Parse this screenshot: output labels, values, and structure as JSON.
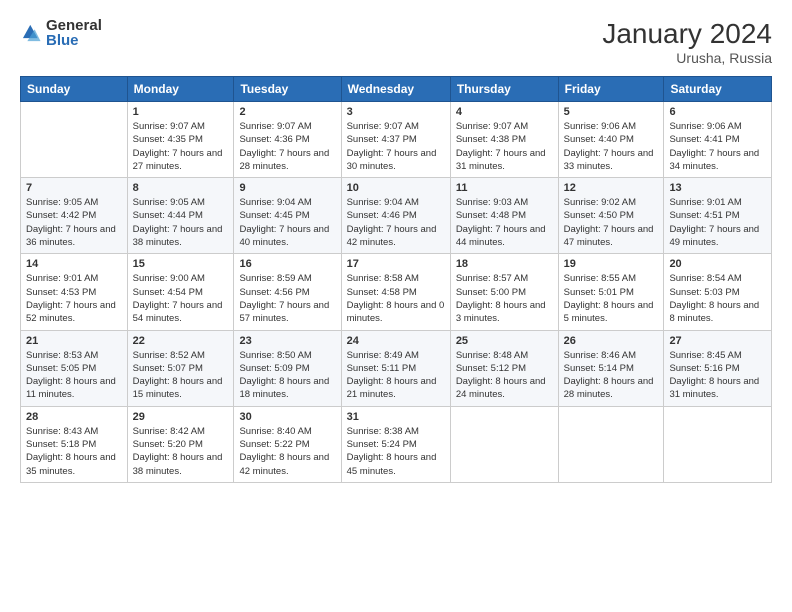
{
  "logo": {
    "general": "General",
    "blue": "Blue"
  },
  "header": {
    "month": "January 2024",
    "location": "Urusha, Russia"
  },
  "columns": [
    "Sunday",
    "Monday",
    "Tuesday",
    "Wednesday",
    "Thursday",
    "Friday",
    "Saturday"
  ],
  "weeks": [
    [
      {
        "day": "",
        "sunrise": "",
        "sunset": "",
        "daylight": ""
      },
      {
        "day": "1",
        "sunrise": "Sunrise: 9:07 AM",
        "sunset": "Sunset: 4:35 PM",
        "daylight": "Daylight: 7 hours and 27 minutes."
      },
      {
        "day": "2",
        "sunrise": "Sunrise: 9:07 AM",
        "sunset": "Sunset: 4:36 PM",
        "daylight": "Daylight: 7 hours and 28 minutes."
      },
      {
        "day": "3",
        "sunrise": "Sunrise: 9:07 AM",
        "sunset": "Sunset: 4:37 PM",
        "daylight": "Daylight: 7 hours and 30 minutes."
      },
      {
        "day": "4",
        "sunrise": "Sunrise: 9:07 AM",
        "sunset": "Sunset: 4:38 PM",
        "daylight": "Daylight: 7 hours and 31 minutes."
      },
      {
        "day": "5",
        "sunrise": "Sunrise: 9:06 AM",
        "sunset": "Sunset: 4:40 PM",
        "daylight": "Daylight: 7 hours and 33 minutes."
      },
      {
        "day": "6",
        "sunrise": "Sunrise: 9:06 AM",
        "sunset": "Sunset: 4:41 PM",
        "daylight": "Daylight: 7 hours and 34 minutes."
      }
    ],
    [
      {
        "day": "7",
        "sunrise": "Sunrise: 9:05 AM",
        "sunset": "Sunset: 4:42 PM",
        "daylight": "Daylight: 7 hours and 36 minutes."
      },
      {
        "day": "8",
        "sunrise": "Sunrise: 9:05 AM",
        "sunset": "Sunset: 4:44 PM",
        "daylight": "Daylight: 7 hours and 38 minutes."
      },
      {
        "day": "9",
        "sunrise": "Sunrise: 9:04 AM",
        "sunset": "Sunset: 4:45 PM",
        "daylight": "Daylight: 7 hours and 40 minutes."
      },
      {
        "day": "10",
        "sunrise": "Sunrise: 9:04 AM",
        "sunset": "Sunset: 4:46 PM",
        "daylight": "Daylight: 7 hours and 42 minutes."
      },
      {
        "day": "11",
        "sunrise": "Sunrise: 9:03 AM",
        "sunset": "Sunset: 4:48 PM",
        "daylight": "Daylight: 7 hours and 44 minutes."
      },
      {
        "day": "12",
        "sunrise": "Sunrise: 9:02 AM",
        "sunset": "Sunset: 4:50 PM",
        "daylight": "Daylight: 7 hours and 47 minutes."
      },
      {
        "day": "13",
        "sunrise": "Sunrise: 9:01 AM",
        "sunset": "Sunset: 4:51 PM",
        "daylight": "Daylight: 7 hours and 49 minutes."
      }
    ],
    [
      {
        "day": "14",
        "sunrise": "Sunrise: 9:01 AM",
        "sunset": "Sunset: 4:53 PM",
        "daylight": "Daylight: 7 hours and 52 minutes."
      },
      {
        "day": "15",
        "sunrise": "Sunrise: 9:00 AM",
        "sunset": "Sunset: 4:54 PM",
        "daylight": "Daylight: 7 hours and 54 minutes."
      },
      {
        "day": "16",
        "sunrise": "Sunrise: 8:59 AM",
        "sunset": "Sunset: 4:56 PM",
        "daylight": "Daylight: 7 hours and 57 minutes."
      },
      {
        "day": "17",
        "sunrise": "Sunrise: 8:58 AM",
        "sunset": "Sunset: 4:58 PM",
        "daylight": "Daylight: 8 hours and 0 minutes."
      },
      {
        "day": "18",
        "sunrise": "Sunrise: 8:57 AM",
        "sunset": "Sunset: 5:00 PM",
        "daylight": "Daylight: 8 hours and 3 minutes."
      },
      {
        "day": "19",
        "sunrise": "Sunrise: 8:55 AM",
        "sunset": "Sunset: 5:01 PM",
        "daylight": "Daylight: 8 hours and 5 minutes."
      },
      {
        "day": "20",
        "sunrise": "Sunrise: 8:54 AM",
        "sunset": "Sunset: 5:03 PM",
        "daylight": "Daylight: 8 hours and 8 minutes."
      }
    ],
    [
      {
        "day": "21",
        "sunrise": "Sunrise: 8:53 AM",
        "sunset": "Sunset: 5:05 PM",
        "daylight": "Daylight: 8 hours and 11 minutes."
      },
      {
        "day": "22",
        "sunrise": "Sunrise: 8:52 AM",
        "sunset": "Sunset: 5:07 PM",
        "daylight": "Daylight: 8 hours and 15 minutes."
      },
      {
        "day": "23",
        "sunrise": "Sunrise: 8:50 AM",
        "sunset": "Sunset: 5:09 PM",
        "daylight": "Daylight: 8 hours and 18 minutes."
      },
      {
        "day": "24",
        "sunrise": "Sunrise: 8:49 AM",
        "sunset": "Sunset: 5:11 PM",
        "daylight": "Daylight: 8 hours and 21 minutes."
      },
      {
        "day": "25",
        "sunrise": "Sunrise: 8:48 AM",
        "sunset": "Sunset: 5:12 PM",
        "daylight": "Daylight: 8 hours and 24 minutes."
      },
      {
        "day": "26",
        "sunrise": "Sunrise: 8:46 AM",
        "sunset": "Sunset: 5:14 PM",
        "daylight": "Daylight: 8 hours and 28 minutes."
      },
      {
        "day": "27",
        "sunrise": "Sunrise: 8:45 AM",
        "sunset": "Sunset: 5:16 PM",
        "daylight": "Daylight: 8 hours and 31 minutes."
      }
    ],
    [
      {
        "day": "28",
        "sunrise": "Sunrise: 8:43 AM",
        "sunset": "Sunset: 5:18 PM",
        "daylight": "Daylight: 8 hours and 35 minutes."
      },
      {
        "day": "29",
        "sunrise": "Sunrise: 8:42 AM",
        "sunset": "Sunset: 5:20 PM",
        "daylight": "Daylight: 8 hours and 38 minutes."
      },
      {
        "day": "30",
        "sunrise": "Sunrise: 8:40 AM",
        "sunset": "Sunset: 5:22 PM",
        "daylight": "Daylight: 8 hours and 42 minutes."
      },
      {
        "day": "31",
        "sunrise": "Sunrise: 8:38 AM",
        "sunset": "Sunset: 5:24 PM",
        "daylight": "Daylight: 8 hours and 45 minutes."
      },
      {
        "day": "",
        "sunrise": "",
        "sunset": "",
        "daylight": ""
      },
      {
        "day": "",
        "sunrise": "",
        "sunset": "",
        "daylight": ""
      },
      {
        "day": "",
        "sunrise": "",
        "sunset": "",
        "daylight": ""
      }
    ]
  ]
}
